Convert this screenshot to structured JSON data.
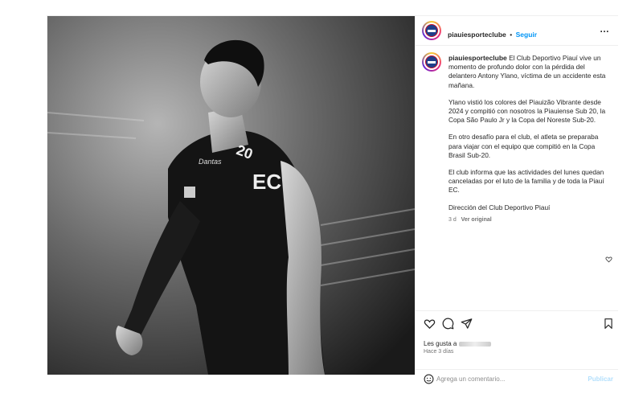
{
  "post": {
    "username": "piauiesporteclube",
    "dot": "•",
    "follow_label": "Seguir",
    "more_label": "…",
    "caption_lead": "El Club Deportivo Piauí vive un momento de profundo dolor con la pérdida del delantero Antony Ylano, víctima de un accidente esta mañana.",
    "paragraphs": [
      "Ylano vistió los colores del Piauizão Vibrante desde 2024 y compitió con nosotros la Piauiense Sub 20, la Copa São Paulo Jr y la Copa del Noreste Sub-20.",
      "En otro desafío para el club, el atleta se preparaba para viajar con el equipo que compitió en la Copa Brasil Sub-20.",
      "El club informa que las actividades del lunes quedan canceladas por el luto de la familia y de toda la Piauí EC.",
      "Dirección del Club Deportivo Piauí"
    ],
    "age": "3 d",
    "see_original": "Ver original",
    "likes_label": "Les gusta a",
    "time_ago": "Hace 3 días",
    "comment_placeholder": "Agrega un comentario...",
    "publish_label": "Publicar",
    "photo_text": {
      "jersey_brand": "Dantas",
      "jersey_badge": "EC",
      "jersey_number": "20"
    }
  },
  "colors": {
    "link": "#0095f6",
    "muted": "#737373",
    "publish": "#b2dffc",
    "border": "#efefef"
  },
  "icons": [
    "heart-icon",
    "comment-icon",
    "share-icon",
    "bookmark-icon",
    "emoji-icon"
  ]
}
